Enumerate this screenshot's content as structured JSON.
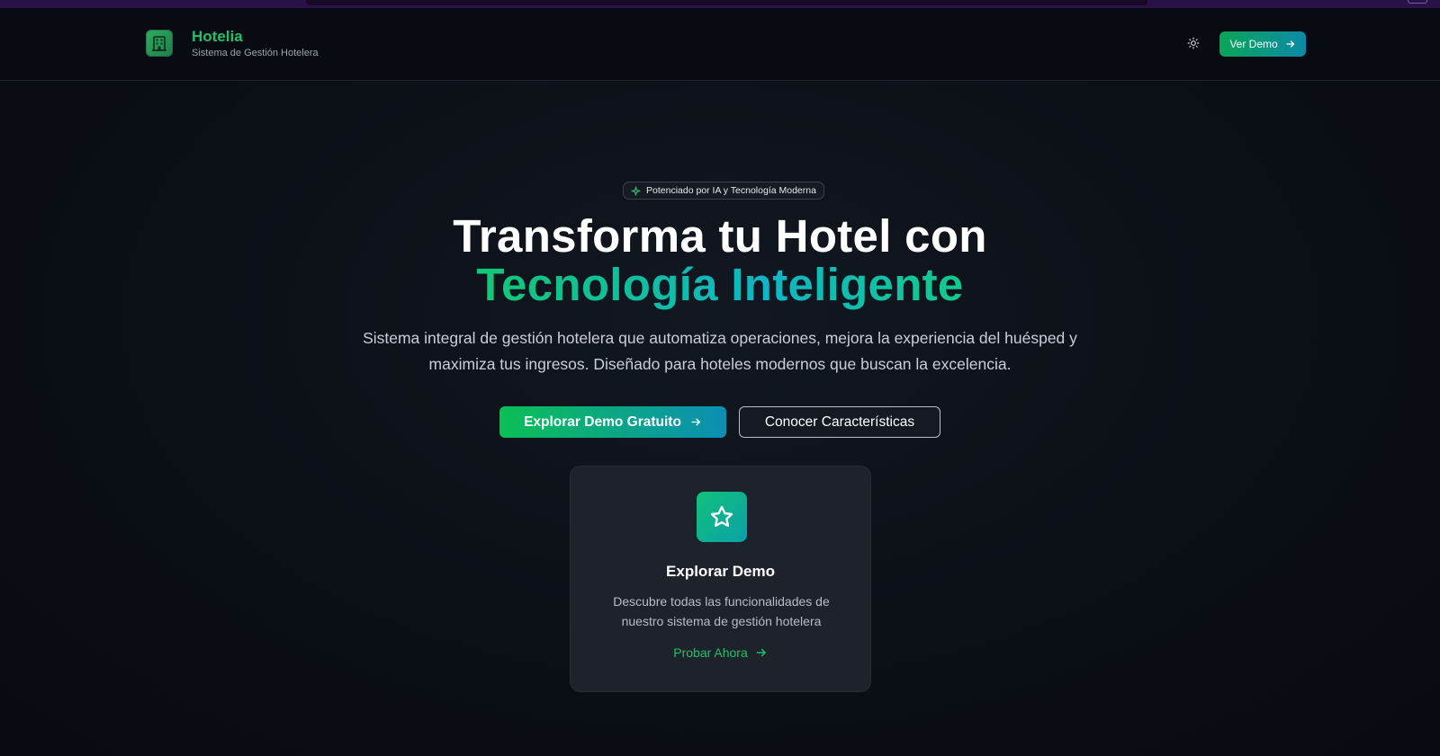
{
  "header": {
    "brand_name": "Hotelia",
    "brand_subtitle": "Sistema de Gestión Hotelera",
    "demo_button": "Ver Demo"
  },
  "hero": {
    "badge": "Potenciado por IA y Tecnología Moderna",
    "title_line1": "Transforma tu Hotel con",
    "title_line2": "Tecnología Inteligente",
    "subtitle_line1": "Sistema integral de gestión hotelera que automatiza operaciones, mejora la experiencia del huésped y",
    "subtitle_line2": "maximiza tus ingresos. Diseñado para hoteles modernos que buscan la excelencia.",
    "primary_button": "Explorar Demo Gratuito",
    "secondary_button": "Conocer Características"
  },
  "card": {
    "title": "Explorar Demo",
    "desc_line1": "Descubre todas las funcionalidades de",
    "desc_line2": "nuestro sistema de gestión hotelera",
    "link": "Probar Ahora"
  },
  "colors": {
    "accent_green": "#22c06a",
    "accent_teal": "#0b8aa7",
    "background": "#070a10"
  },
  "icons": {
    "logo": "hotel-building-icon",
    "theme": "sun-icon",
    "badge": "sparkle-icon",
    "arrow": "arrow-right-icon",
    "card": "star-icon"
  }
}
